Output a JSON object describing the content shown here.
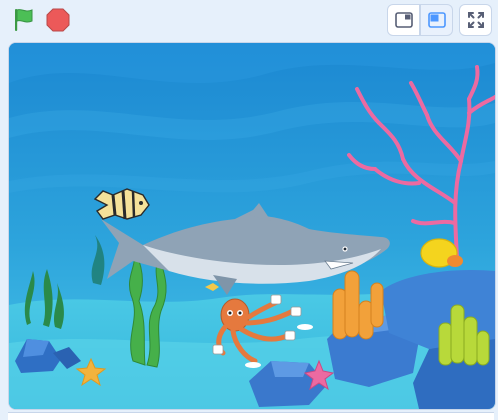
{
  "controls": {
    "green_flag_icon": "green-flag-icon",
    "stop_icon": "stop-sign-icon",
    "small_stage_icon": "small-stage-icon",
    "large_stage_icon": "large-stage-icon",
    "fullscreen_icon": "fullscreen-icon"
  },
  "stage": {
    "backdrop": "underwater",
    "sprites": [
      "angelfish",
      "shark",
      "octopus"
    ]
  },
  "colors": {
    "flag_green": "#4cbf56",
    "stop_red": "#ec5959",
    "accent_blue": "#4c97ff",
    "water_top": "#1a8fd6",
    "water_bottom": "#49c6e8",
    "coral_pink": "#ec6aa1"
  }
}
